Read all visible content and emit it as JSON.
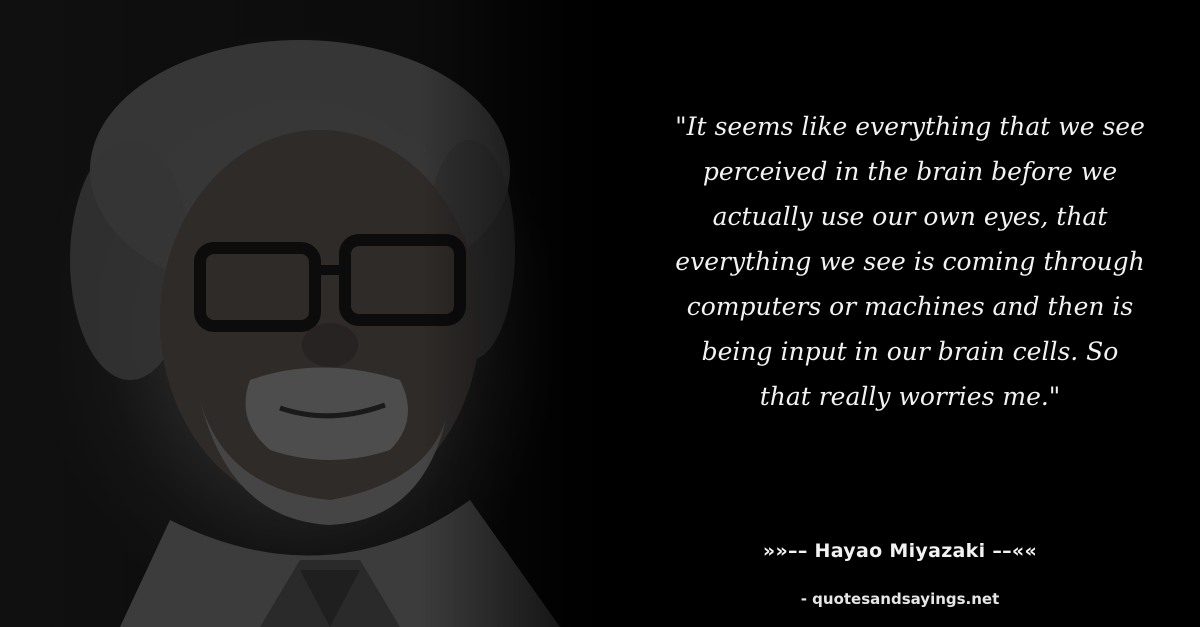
{
  "image": {
    "subject": "portrait-photo",
    "palette": {
      "background": "#000000",
      "text": "#f2f2f2"
    }
  },
  "quote": {
    "lines": [
      "\"It seems like everything that we see",
      "perceived in the brain before we",
      "actually use our own eyes, that",
      "everything we see is coming through",
      "computers or machines and then is",
      "being input in our brain cells. So",
      "that really worries me.\""
    ]
  },
  "attribution": {
    "author": "»»–– Hayao Miyazaki ––««",
    "source": "- quotesandsayings.net"
  }
}
